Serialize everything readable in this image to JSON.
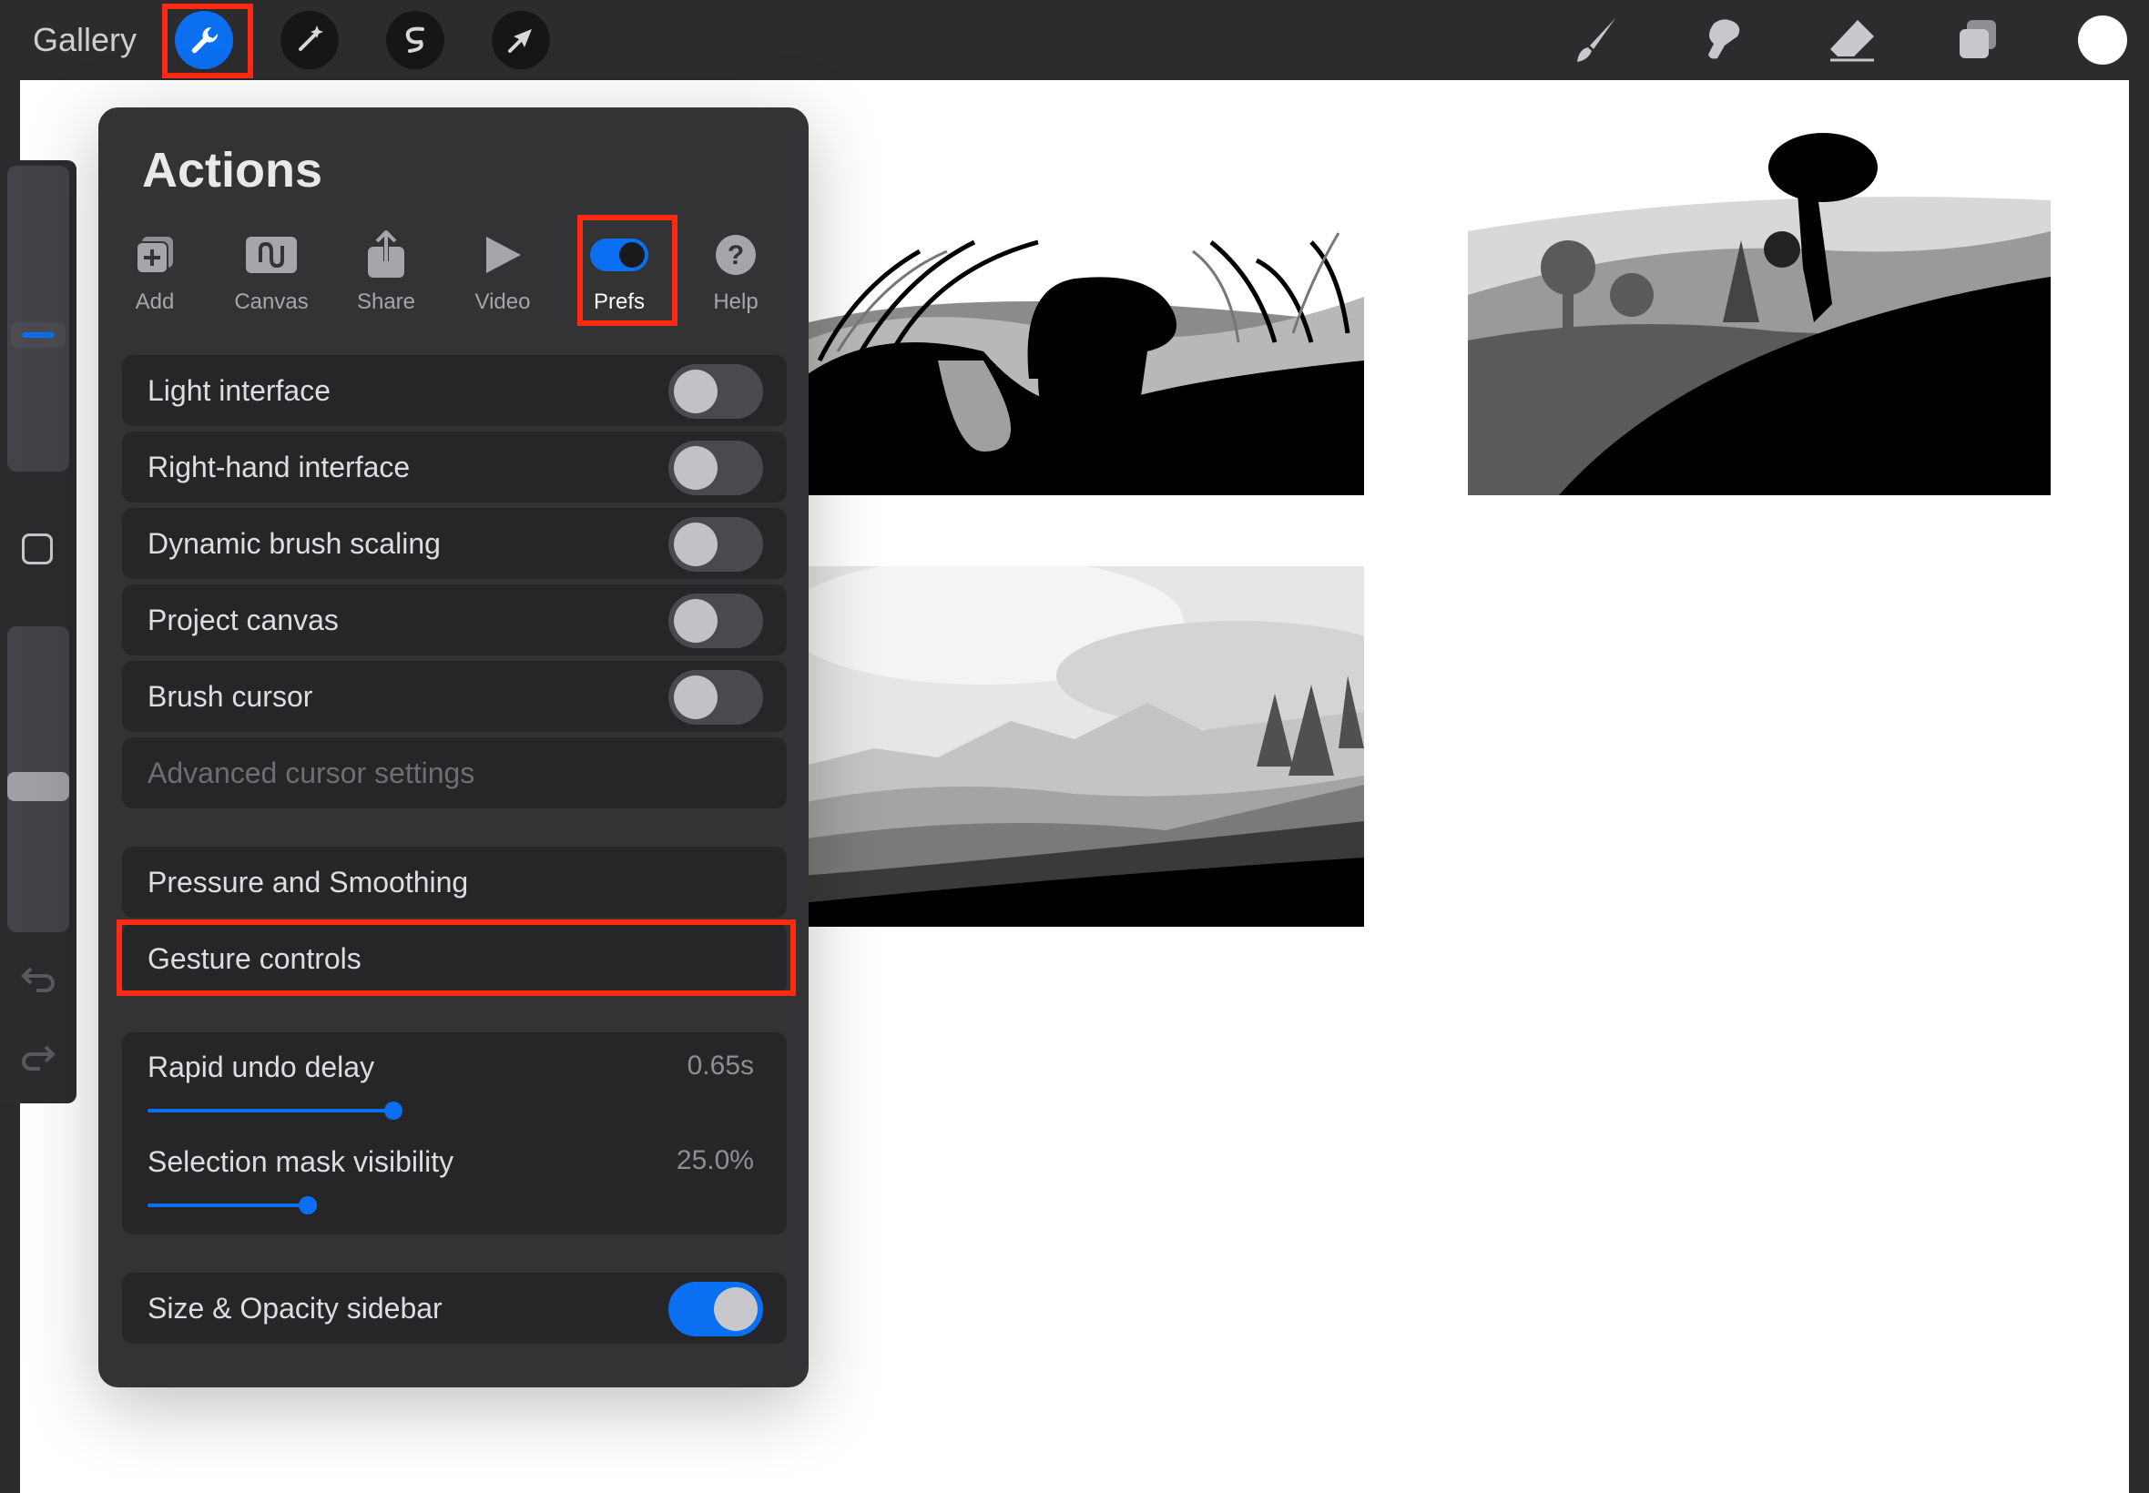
{
  "topbar": {
    "gallery_label": "Gallery",
    "tools": [
      {
        "name": "actions",
        "icon": "wrench-icon",
        "active": true
      },
      {
        "name": "adjustments",
        "icon": "magic-wand-icon"
      },
      {
        "name": "selection",
        "icon": "selection-icon"
      },
      {
        "name": "transform",
        "icon": "arrow-cursor-icon"
      }
    ],
    "right_tools": [
      "brush-icon",
      "smudge-icon",
      "eraser-icon",
      "layers-icon"
    ],
    "color_swatch": "#ffffff"
  },
  "actions_panel": {
    "title": "Actions",
    "tabs": [
      {
        "label": "Add",
        "icon": "add-icon"
      },
      {
        "label": "Canvas",
        "icon": "canvas-icon"
      },
      {
        "label": "Share",
        "icon": "share-icon"
      },
      {
        "label": "Video",
        "icon": "play-icon"
      },
      {
        "label": "Prefs",
        "icon": "toggle-icon",
        "selected": true
      },
      {
        "label": "Help",
        "icon": "help-icon"
      }
    ],
    "toggles": [
      {
        "label": "Light interface",
        "on": false
      },
      {
        "label": "Right-hand interface",
        "on": false
      },
      {
        "label": "Dynamic brush scaling",
        "on": false
      },
      {
        "label": "Project canvas",
        "on": false
      },
      {
        "label": "Brush cursor",
        "on": false
      }
    ],
    "advanced_cursor": "Advanced cursor settings",
    "pressure_smoothing": "Pressure and Smoothing",
    "gesture_controls": "Gesture controls",
    "sliders": [
      {
        "label": "Rapid undo delay",
        "value": "0.65s",
        "fraction": 0.4
      },
      {
        "label": "Selection mask visibility",
        "value": "25.0%",
        "fraction": 0.25
      }
    ],
    "sidebar_toggle": {
      "label": "Size & Opacity sidebar",
      "on": true
    }
  },
  "colors": {
    "accent": "#0a6ff0",
    "highlight": "#ff2a12",
    "panel": "#333336"
  }
}
